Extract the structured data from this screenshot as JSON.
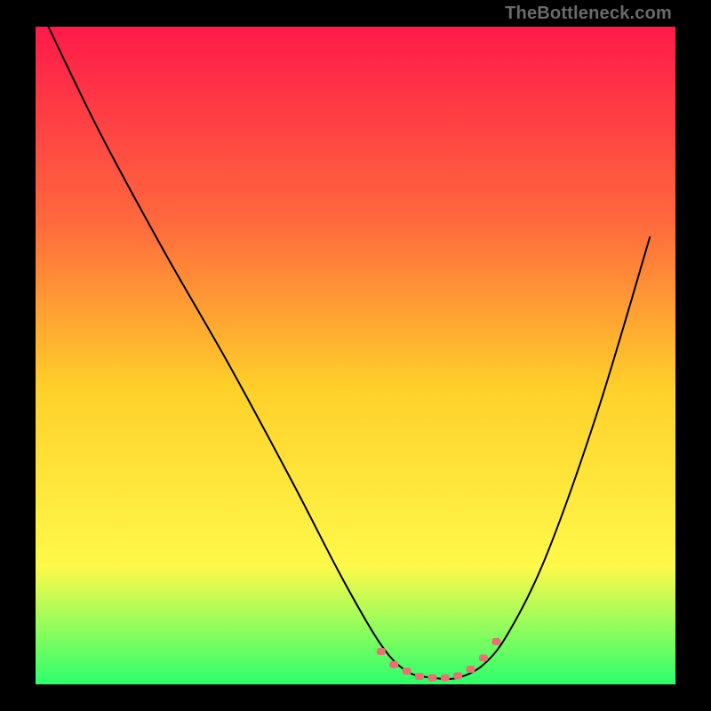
{
  "watermark": "TheBottleneck.com",
  "colors": {
    "gradient_top": "#ff1a4a",
    "gradient_mid1": "#ff6a3d",
    "gradient_mid2": "#ffd02a",
    "gradient_mid3": "#fff94a",
    "gradient_bottom": "#2dff6e",
    "curve": "#000000",
    "marker": "#e57373",
    "frame": "#000000"
  },
  "chart_data": {
    "type": "line",
    "title": "",
    "xlabel": "",
    "ylabel": "",
    "xlim": [
      0,
      100
    ],
    "ylim": [
      0,
      100
    ],
    "series": [
      {
        "name": "bottleneck-curve",
        "x": [
          2,
          10,
          20,
          30,
          40,
          48,
          54,
          58,
          62,
          66,
          70,
          74,
          80,
          88,
          96
        ],
        "values": [
          100,
          84,
          66,
          49,
          31,
          16,
          6,
          2,
          1,
          1,
          3,
          8,
          20,
          42,
          68
        ]
      }
    ],
    "markers": {
      "name": "highlight-band",
      "x": [
        54,
        56,
        58,
        60,
        62,
        64,
        66,
        68,
        70,
        72
      ],
      "values": [
        5,
        3,
        2,
        1.2,
        1,
        1,
        1.3,
        2.3,
        4,
        6.5
      ]
    }
  }
}
